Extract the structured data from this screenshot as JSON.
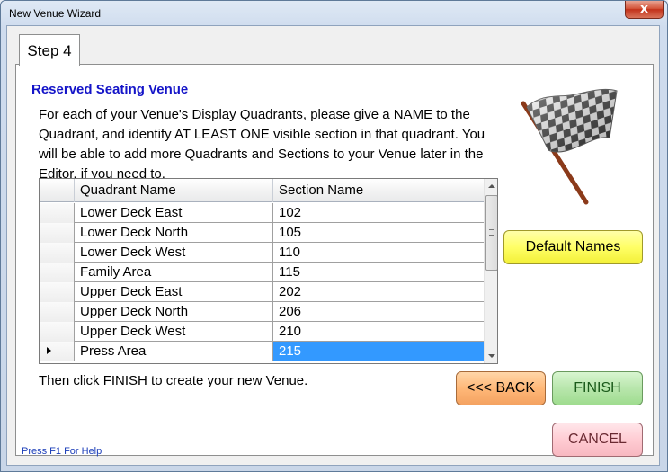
{
  "window": {
    "title": "New Venue Wizard",
    "close_glyph": "x"
  },
  "tab": {
    "label": "Step 4"
  },
  "content": {
    "heading": "Reserved Seating Venue",
    "instructions": "For each of your Venue's Display Quadrants, please give a NAME to the Quadrant, and identify AT LEAST ONE visible section in that quadrant.  You will be able to add more Quadrants and Sections to your Venue later in the Editor, if you need to.",
    "footer_instruction": "Then click FINISH to create your new Venue."
  },
  "grid": {
    "columns": [
      "Quadrant Name",
      "Section Name"
    ],
    "rows": [
      {
        "quadrant": "Lower Deck East",
        "section": "102"
      },
      {
        "quadrant": "Lower Deck North",
        "section": "105"
      },
      {
        "quadrant": "Lower Deck West",
        "section": "110"
      },
      {
        "quadrant": "Family Area",
        "section": "115"
      },
      {
        "quadrant": "Upper Deck East",
        "section": "202"
      },
      {
        "quadrant": "Upper Deck North",
        "section": "206"
      },
      {
        "quadrant": "Upper Deck West",
        "section": "210"
      },
      {
        "quadrant": "Press Area",
        "section": "215",
        "current": true
      }
    ]
  },
  "buttons": {
    "default_names": "Default Names",
    "back": "<<< BACK",
    "finish": "FINISH",
    "cancel": "CANCEL"
  },
  "help": {
    "text": "Press F1 For Help"
  },
  "colors": {
    "heading": "#1414c8",
    "selection": "#3399ff",
    "default_button": "#ffff66",
    "back_button": "#ffb878",
    "finish_button": "#b8e6ac",
    "cancel_button": "#ffccd3"
  },
  "icons": {
    "flag": "checkered-flag-icon",
    "row_indicator": "row-pointer-icon"
  }
}
